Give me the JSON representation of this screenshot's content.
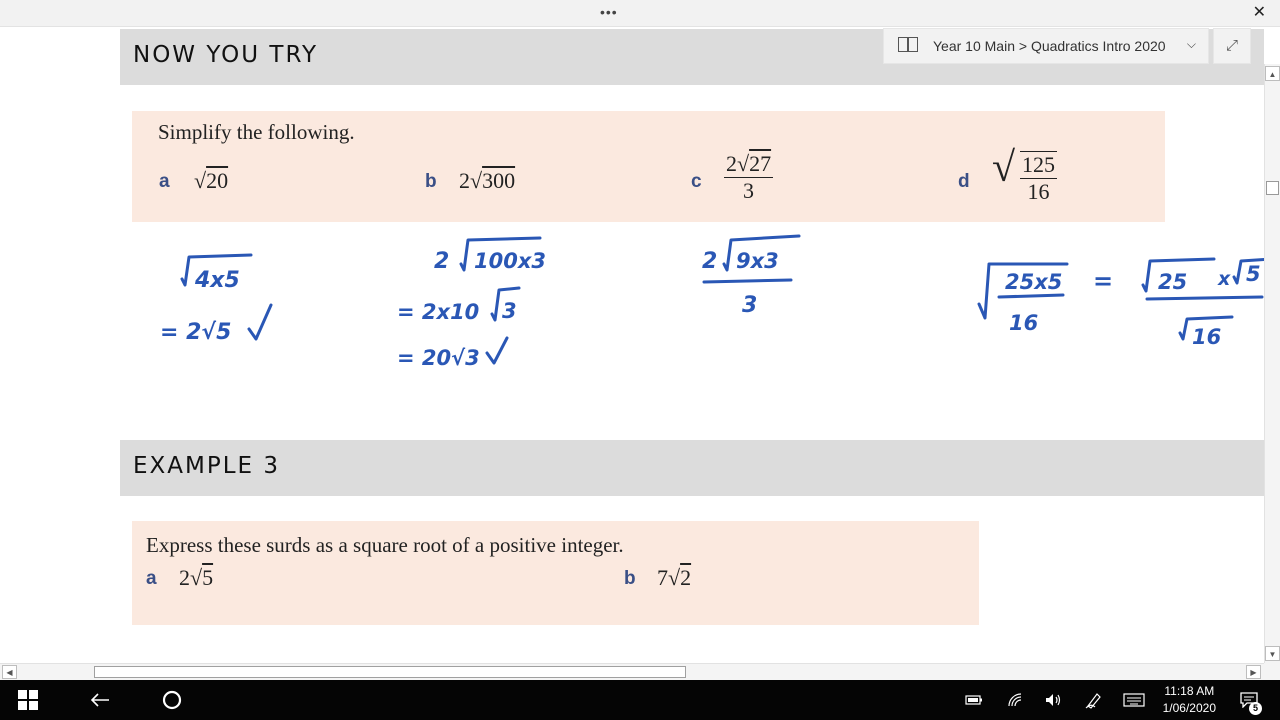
{
  "window": {
    "more_label": "•••",
    "close_label": "✕"
  },
  "breadcrumb": {
    "text": "Year 10 Main > Quadratics Intro 2020",
    "chevron": "⌵",
    "expand": "⤢"
  },
  "section1": {
    "title": "NOW YOU TRY",
    "prompt": "Simplify the following.",
    "items": [
      {
        "letter": "a",
        "coef": "",
        "radicand": "20"
      },
      {
        "letter": "b",
        "coef": "2",
        "radicand": "300"
      },
      {
        "letter": "c",
        "num_coef": "2",
        "num_radicand": "27",
        "den": "3"
      },
      {
        "letter": "d",
        "num": "125",
        "den": "16"
      }
    ]
  },
  "handwriting": {
    "a_line1": "4x5",
    "a_line2": "= 2√5",
    "b_line1": "2",
    "b_line1_rad": "100x3",
    "b_line2": "= 2x10",
    "b_line2_rad": "3",
    "b_line3": "= 20√3",
    "c_coef": "2",
    "c_rad": "9x3",
    "c_den": "3",
    "d_num": "25x5",
    "d_den": "16",
    "d_eq": "=",
    "d_rhs_num": "25",
    "d_rhs_times": "x",
    "d_rhs_rad2": "5",
    "d_rhs_den": "16"
  },
  "section2": {
    "title": "EXAMPLE 3",
    "prompt": "Express these surds as a square root of a positive integer.",
    "items": [
      {
        "letter": "a",
        "coef": "2",
        "radicand": "5"
      },
      {
        "letter": "b",
        "coef": "7",
        "radicand": "2"
      }
    ]
  },
  "taskbar": {
    "time": "11:18 AM",
    "date": "1/06/2020",
    "notification_count": "5"
  }
}
